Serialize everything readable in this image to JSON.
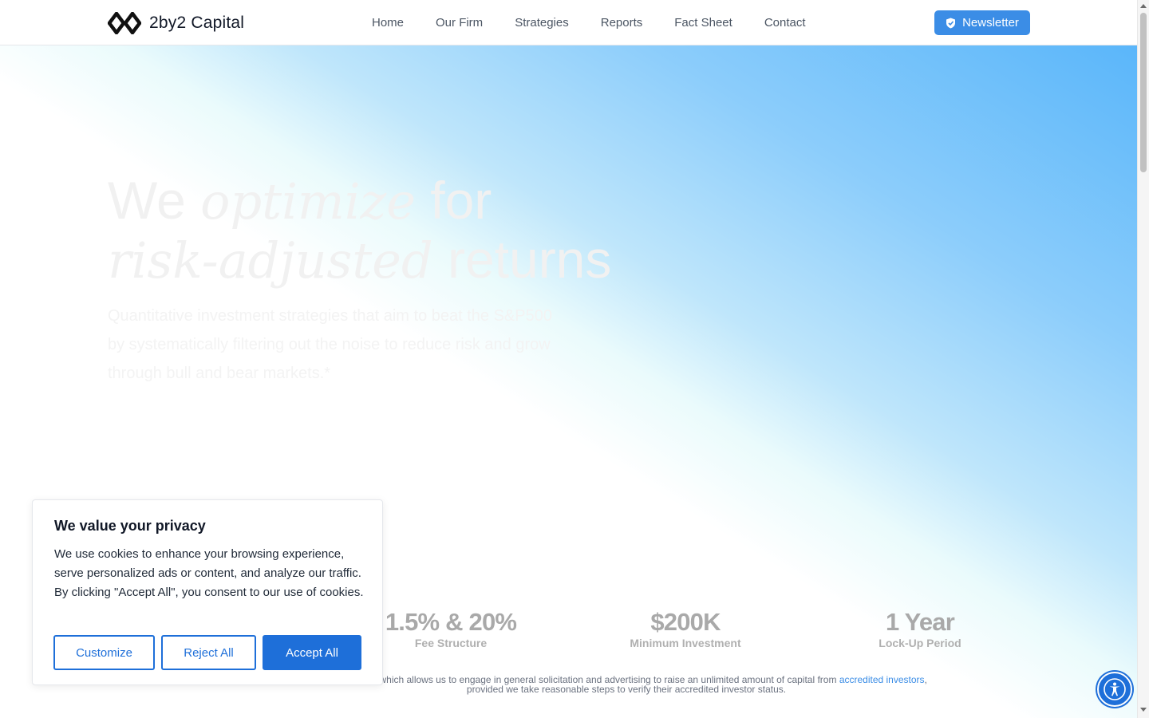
{
  "brand": {
    "name": "2by2 Capital",
    "logo_icon": "double-diamond-logo-icon"
  },
  "nav": {
    "items": [
      {
        "label": "Home"
      },
      {
        "label": "Our Firm"
      },
      {
        "label": "Strategies"
      },
      {
        "label": "Reports"
      },
      {
        "label": "Fact Sheet"
      },
      {
        "label": "Contact"
      }
    ],
    "newsletter_label": "Newsletter",
    "newsletter_icon": "shield-check-icon"
  },
  "hero": {
    "line1_a": "We ",
    "line1_it": "optimize",
    "line1_b": " for",
    "line2_it": "risk-adjusted",
    "line2_b": " returns",
    "subtitle": "Quantitative investment strategies that aim to beat the S&P500 by systematically filtering out the noise to reduce risk and grow through bull and bear markets.*"
  },
  "stats": [
    {
      "value": "1.5% & 20%",
      "label": "Fee Structure"
    },
    {
      "value": "$200K",
      "label": "Minimum Investment"
    },
    {
      "value": "1 Year",
      "label": "Lock-Up Period"
    }
  ],
  "disclaimer": {
    "line1": "egulation D, which allows us to engage in general solicitation and advertising to raise an unlimited amount of capital from ",
    "link": "accredited investors",
    "line1_end": ",",
    "line2": "provided we take reasonable steps to verify their accredited investor status."
  },
  "cookie": {
    "title": "We value your privacy",
    "body": "We use cookies to enhance your browsing experience, serve personalized ads or content, and analyze our traffic. By clicking \"Accept All\", you consent to our use of cookies.",
    "customize": "Customize",
    "reject": "Reject All",
    "accept": "Accept All"
  },
  "accessibility_icon": "accessibility-person-icon",
  "colors": {
    "accent": "#1e6fd9",
    "newsletter": "#3b8de6",
    "gradient": "#5ab6fa"
  }
}
